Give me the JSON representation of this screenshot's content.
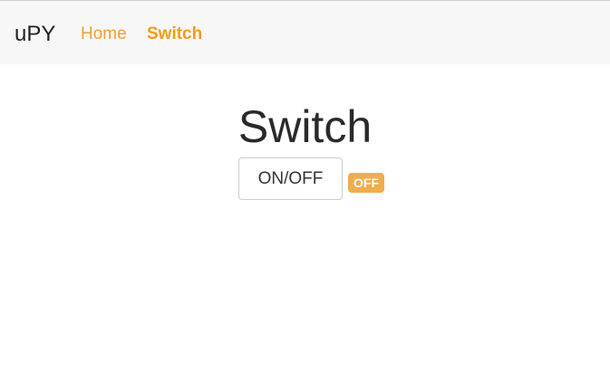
{
  "navbar": {
    "brand": "uPY",
    "links": [
      {
        "label": "Home",
        "active": false
      },
      {
        "label": "Switch",
        "active": true
      }
    ],
    "link_color": "#f0a030"
  },
  "main": {
    "title": "Switch",
    "toggle_button_label": "ON/OFF",
    "status": "OFF",
    "status_color": "#f0ad4e"
  }
}
